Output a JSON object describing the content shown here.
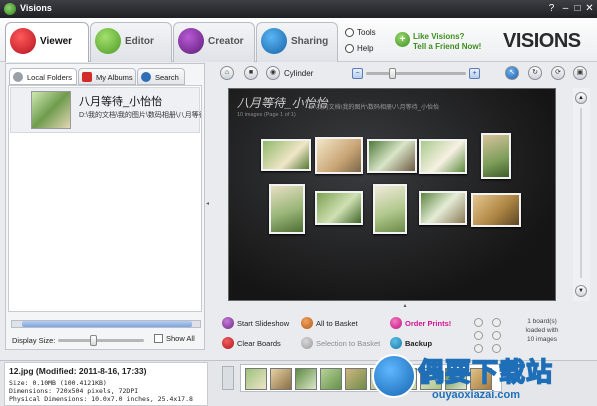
{
  "app": {
    "title": "Visions"
  },
  "window": {
    "help": "?",
    "minimize": "–",
    "maximize": "□",
    "close": "✕"
  },
  "tabs": [
    {
      "label": "Viewer",
      "icon": "viewer-icon",
      "color": "#d21c2c"
    },
    {
      "label": "Editor",
      "icon": "brush-icon",
      "color": "#6bbf3a"
    },
    {
      "label": "Creator",
      "icon": "creator-icon",
      "color": "#7d2d9a"
    },
    {
      "label": "Sharing",
      "icon": "sharing-icon",
      "color": "#1f7fc8"
    }
  ],
  "menu": {
    "tools": "Tools",
    "help": "Help"
  },
  "promo": {
    "line1": "Like Visions?",
    "line2": "Tell a Friend Now!"
  },
  "brand": "VISIONS",
  "left_tabs": [
    "Local Folders",
    "My Albums",
    "Search"
  ],
  "folder": {
    "name": "八月等待_小怡怡",
    "path": "D:\\我的文档\\我的图片\\数码相册\\八月等待_小怡怡"
  },
  "display": {
    "label": "Display Size:",
    "show_all": "Show All",
    "size_level": 0.4
  },
  "toolbar": {
    "view_mode": "Cylinder",
    "zoom_level": 0.25
  },
  "board": {
    "title": "八月等待_小怡怡",
    "path": "D:\\我的文档\\我的图片\\数码相册\\八月等待_小怡怡",
    "subtitle": "10 images (Page 1 of 1)"
  },
  "actions": {
    "start_slideshow": "Start Slideshow",
    "all_to_basket": "All to Basket",
    "order_prints": "Order Prints!",
    "clear_boards": "Clear Boards",
    "selection_to_basket": "Selection to Basket",
    "backup": "Backup"
  },
  "board_info": {
    "line1": "1 board(s)",
    "line2": "loaded with",
    "line3": "10 images"
  },
  "file_info": {
    "title": "12.jpg (Modified: 2011-8-16, 17:33)",
    "size": "Size: 0.10MB (100.4121KB)",
    "dimensions": "Dimensions: 720x504 pixels, 72DPI",
    "physical": "Physical Dimensions: 10.0x7.0 inches, 25.4x17.8"
  },
  "watermark": {
    "big": "偶要下载站",
    "small": "ouyaoxiazai.com"
  }
}
